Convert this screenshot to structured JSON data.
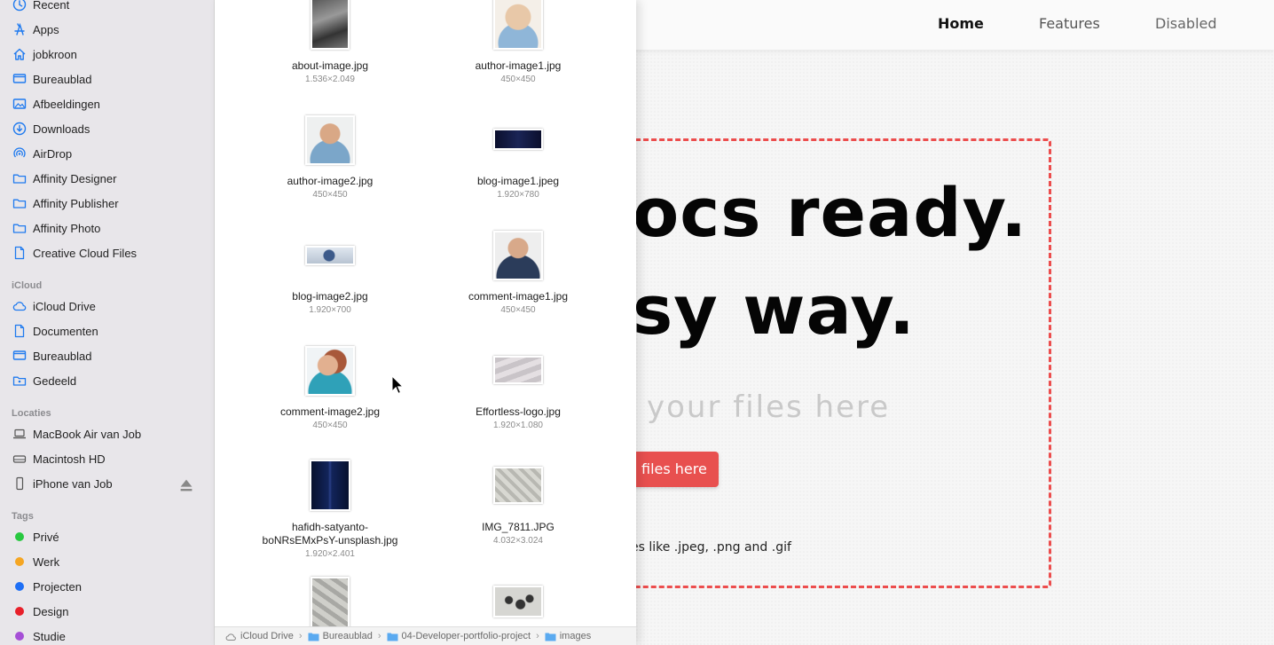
{
  "website": {
    "nav": [
      {
        "label": "Home",
        "active": true
      },
      {
        "label": "Features",
        "active": false
      },
      {
        "label": "Disabled",
        "active": false
      }
    ],
    "hero_line_1": "ocs ready.",
    "hero_line_2": "sy way.",
    "drop_hint": "your files here",
    "upload_button": "files here",
    "file_types": "es like .jpeg, .png and .gif",
    "accent_color": "#e8504f"
  },
  "sidebar": {
    "favorites": [
      {
        "label": "Recent",
        "icon": "clock-icon"
      },
      {
        "label": "Apps",
        "icon": "apps-icon"
      },
      {
        "label": "jobkroon",
        "icon": "home-icon"
      },
      {
        "label": "Bureaublad",
        "icon": "desktop-icon"
      },
      {
        "label": "Afbeeldingen",
        "icon": "pictures-icon"
      },
      {
        "label": "Downloads",
        "icon": "downloads-icon"
      },
      {
        "label": "AirDrop",
        "icon": "airdrop-icon"
      },
      {
        "label": "Affinity Designer",
        "icon": "folder-icon"
      },
      {
        "label": "Affinity Publisher",
        "icon": "folder-icon"
      },
      {
        "label": "Affinity Photo",
        "icon": "folder-icon"
      },
      {
        "label": "Creative Cloud Files",
        "icon": "document-icon"
      }
    ],
    "icloud_heading": "iCloud",
    "icloud": [
      {
        "label": "iCloud Drive",
        "icon": "cloud-icon"
      },
      {
        "label": "Documenten",
        "icon": "document-icon"
      },
      {
        "label": "Bureaublad",
        "icon": "desktop-icon"
      },
      {
        "label": "Gedeeld",
        "icon": "shared-folder-icon"
      }
    ],
    "locations_heading": "Locaties",
    "locations": [
      {
        "label": "MacBook Air van Job",
        "icon": "laptop-icon"
      },
      {
        "label": "Macintosh HD",
        "icon": "disk-icon"
      },
      {
        "label": "iPhone van Job",
        "icon": "iphone-icon"
      }
    ],
    "tags_heading": "Tags",
    "tags": [
      {
        "label": "Privé",
        "color": "#28c840"
      },
      {
        "label": "Werk",
        "color": "#f5a623"
      },
      {
        "label": "Projecten",
        "color": "#1e6ff5"
      },
      {
        "label": "Design",
        "color": "#e8202a"
      },
      {
        "label": "Studie",
        "color": "#a54fd6"
      }
    ]
  },
  "files": [
    {
      "name": "about-image.jpg",
      "dims": "1.536×2.049"
    },
    {
      "name": "author-image1.jpg",
      "dims": "450×450"
    },
    {
      "name": "author-image2.jpg",
      "dims": "450×450"
    },
    {
      "name": "blog-image1.jpeg",
      "dims": "1.920×780"
    },
    {
      "name": "blog-image2.jpg",
      "dims": "1.920×700"
    },
    {
      "name": "comment-image1.jpg",
      "dims": "450×450"
    },
    {
      "name": "comment-image2.jpg",
      "dims": "450×450"
    },
    {
      "name": "Effortless-logo.jpg",
      "dims": "1.920×1.080"
    },
    {
      "name": "hafidh-satyanto-boNRsEMxPsY-unsplash.jpg",
      "name_line_1": "hafidh-satyanto-",
      "name_line_2": "boNRsEMxPsY-unsplash.jpg",
      "dims": "1.920×2.401"
    },
    {
      "name": "IMG_7811.JPG",
      "dims": "4.032×3.024"
    }
  ],
  "pathbar": [
    {
      "label": "iCloud Drive",
      "icon": "cloud-icon"
    },
    {
      "label": "Bureaublad",
      "icon": "folder-icon"
    },
    {
      "label": "04-Developer-portfolio-project",
      "icon": "folder-icon"
    },
    {
      "label": "images",
      "icon": "folder-icon"
    }
  ]
}
